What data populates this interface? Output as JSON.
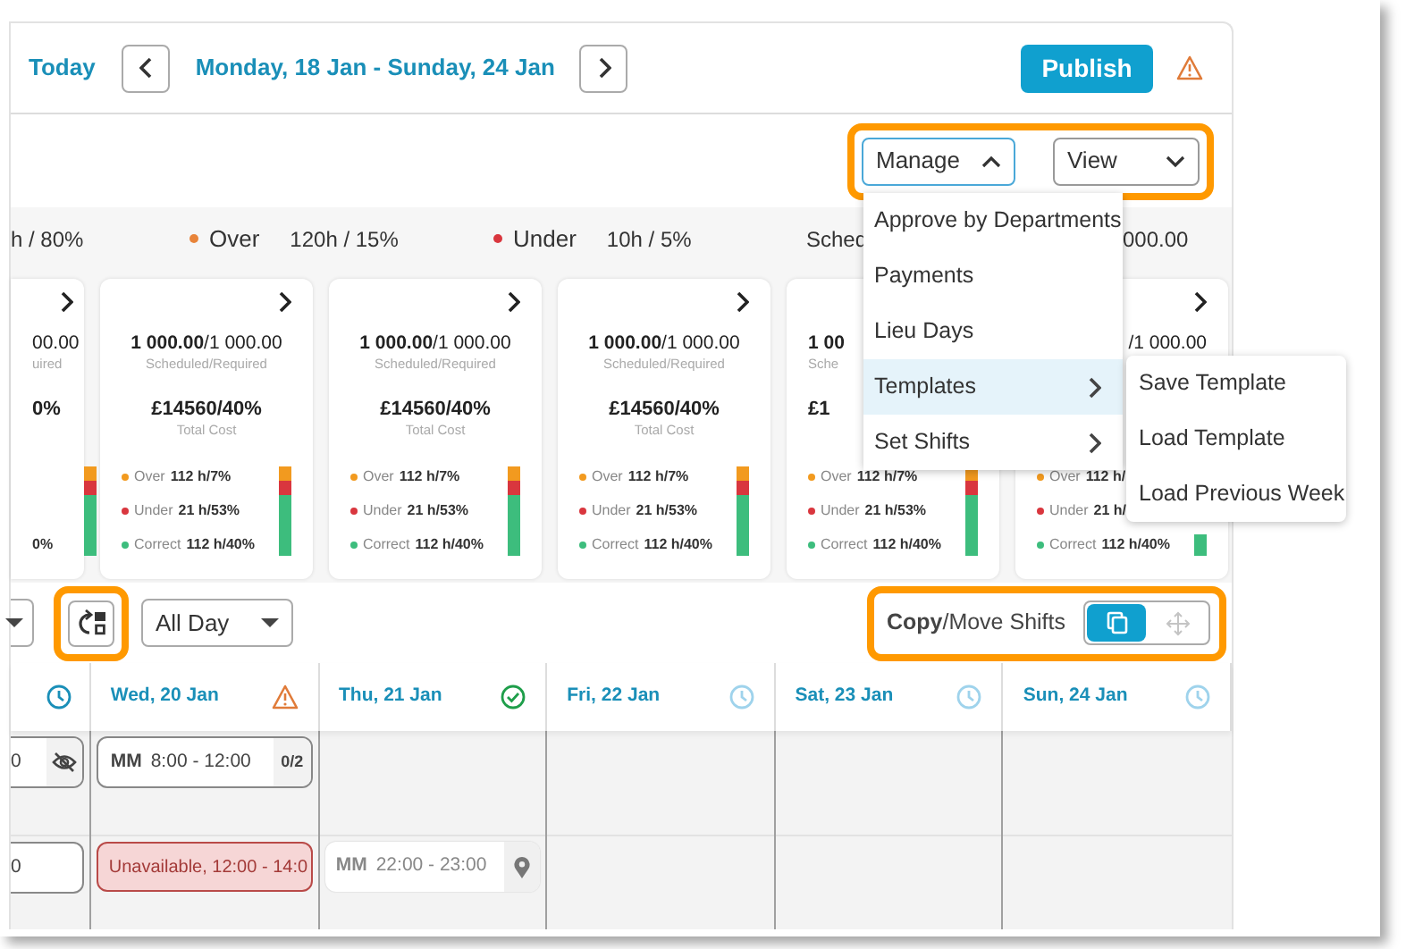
{
  "header": {
    "today": "Today",
    "date_range": "Monday, 18 Jan - Sunday, 24 Jan",
    "publish": "Publish"
  },
  "toolbar": {
    "highlighted": true,
    "manage": {
      "label": "Manage",
      "expanded": true
    },
    "view": {
      "label": "View",
      "expanded": false
    }
  },
  "manage_menu": [
    {
      "label": "Approve by Departments",
      "selected": false,
      "submenu": false
    },
    {
      "label": "Payments",
      "selected": false,
      "submenu": false
    },
    {
      "label": "Lieu Days",
      "selected": false,
      "submenu": false
    },
    {
      "label": "Templates",
      "selected": true,
      "submenu": true
    },
    {
      "label": "Set Shifts",
      "selected": false,
      "submenu": true
    }
  ],
  "templates_submenu": [
    "Save Template",
    "Load Template",
    "Load Previous Week"
  ],
  "summary": [
    {
      "kind": "plain",
      "value": "h / 80%"
    },
    {
      "kind": "dot",
      "label": "Over",
      "value": "120h / 15%",
      "color": "#e8843a"
    },
    {
      "kind": "dot",
      "label": "Under",
      "value": "10h / 5%",
      "color": "#d9363e"
    },
    {
      "kind": "plain",
      "label": "Sched",
      "value": "000.00"
    }
  ],
  "cards": [
    {
      "kind": "edge",
      "chevron": true,
      "amount": "00.00",
      "amount_caption": "uired",
      "cost": "0%",
      "legend": [
        {
          "value": "0%"
        }
      ]
    },
    {
      "kind": "whole",
      "chevron": true,
      "amount": "**1 000.00**/1 000.00",
      "amount_caption": "Scheduled/Required",
      "cost": "£14560/40%",
      "cost_caption": "Total Cost",
      "legend": [
        {
          "label": "Over",
          "value": "112 h/7%",
          "color": "#f29a1f"
        },
        {
          "label": "Under",
          "value": "21 h/53%",
          "color": "#d9363e"
        },
        {
          "label": "Correct",
          "value": "112 h/40%",
          "color": "#3dbd7d"
        }
      ]
    },
    {
      "kind": "whole",
      "chevron": true,
      "amount": "**1 000.00**/1 000.00",
      "amount_caption": "Scheduled/Required",
      "cost": "£14560/40%",
      "cost_caption": "Total Cost",
      "legend": [
        {
          "label": "Over",
          "value": "112 h/7%",
          "color": "#f29a1f"
        },
        {
          "label": "Under",
          "value": "21 h/53%",
          "color": "#d9363e"
        },
        {
          "label": "Correct",
          "value": "112 h/40%",
          "color": "#3dbd7d"
        }
      ]
    },
    {
      "kind": "whole",
      "chevron": true,
      "amount": "**1 000.00**/1 000.00",
      "amount_caption": "Scheduled/Required",
      "cost": "£14560/40%",
      "cost_caption": "Total Cost",
      "legend": [
        {
          "label": "Over",
          "value": "112 h/7%",
          "color": "#f29a1f"
        },
        {
          "label": "Under",
          "value": "21 h/53%",
          "color": "#d9363e"
        },
        {
          "label": "Correct",
          "value": "112 h/40%",
          "color": "#3dbd7d"
        }
      ]
    },
    {
      "kind": "covered-right",
      "chevron": false,
      "amount": "**1 00**",
      "amount_caption": "Sche",
      "cost": "£1",
      "legend": [
        {
          "label": "Over",
          "value": "112 h/7%",
          "color": "#f29a1f"
        },
        {
          "label": "Under",
          "value": "21 h/53%",
          "color": "#d9363e"
        },
        {
          "label": "Correct",
          "value": "112 h/40%",
          "color": "#3dbd7d"
        }
      ]
    },
    {
      "kind": "covered-left",
      "chevron": true,
      "amount": "/1 000.00",
      "legend": [
        {
          "label": "Over",
          "value": "112 h/",
          "color": "#f29a1f"
        },
        {
          "label": "Under",
          "value": "21 h/",
          "color": "#d9363e"
        },
        {
          "label": "Correct",
          "value": "112 h/40%",
          "color": "#3dbd7d"
        }
      ]
    }
  ],
  "filters": {
    "layout_highlighted": true,
    "period": "All Day"
  },
  "copy_move": {
    "highlighted": true,
    "label": "**Copy**/Move Shifts",
    "copy_selected": true,
    "move_selected": false
  },
  "days": [
    {
      "kind": "active"
    },
    {
      "label": "Wed, 20 Jan",
      "kind": "warning"
    },
    {
      "label": "Thu, 21 Jan",
      "kind": "ok"
    },
    {
      "label": "Fri, 22 Jan",
      "kind": "idle"
    },
    {
      "label": "Sat, 23 Jan",
      "kind": "idle"
    },
    {
      "label": "Sun, 24 Jan",
      "kind": "idle"
    }
  ],
  "grid_rows": [
    {
      "cells": [
        {
          "kind": "open",
          "time": "0",
          "hidden": true
        },
        {
          "kind": "open",
          "initials": "MM",
          "time": "8:00 - 12:00",
          "count": "0/2"
        },
        {
          "kind": "empty"
        },
        {
          "kind": "empty"
        },
        {
          "kind": "empty"
        },
        {
          "kind": "empty"
        }
      ]
    },
    {
      "cells": [
        {
          "kind": "open",
          "time": "0"
        },
        {
          "kind": "unavailable",
          "text": "Unavailable, 12:00 - 14:0"
        },
        {
          "kind": "assigned",
          "initials": "MM",
          "time": "22:00 - 23:00",
          "location": true
        },
        {
          "kind": "empty"
        },
        {
          "kind": "empty"
        },
        {
          "kind": "empty"
        }
      ]
    }
  ]
}
